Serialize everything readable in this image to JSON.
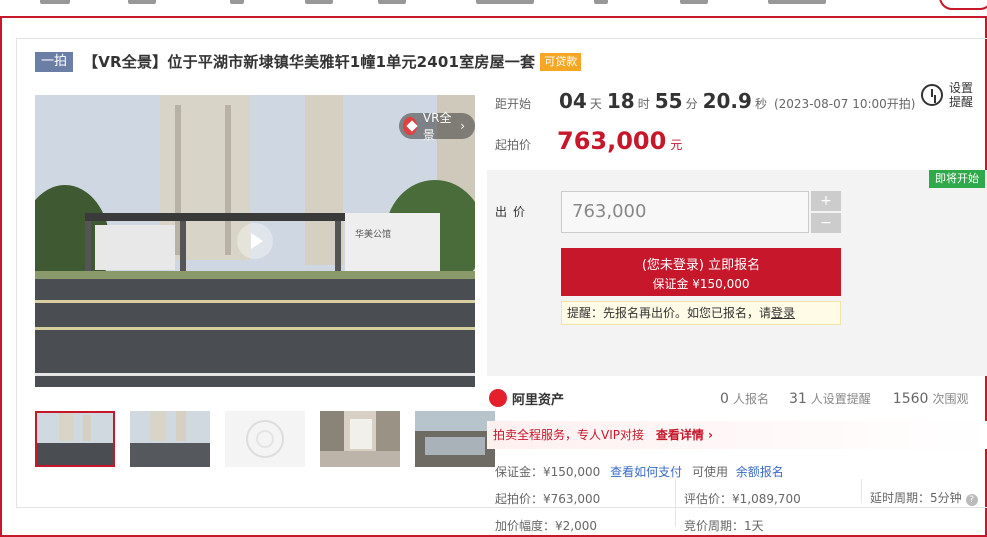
{
  "title": {
    "tag": "一拍",
    "text": "【VR全景】位于平湖市新埭镇华美雅轩1幢1单元2401室房屋一套",
    "loan_badge": "可贷款"
  },
  "media": {
    "vr_label": "VR全景",
    "gate_sign": "华美公馆",
    "thumbnail_count": 5
  },
  "countdown": {
    "label": "距开始",
    "days": "04",
    "days_unit": "天",
    "hours": "18",
    "hours_unit": "时",
    "minutes": "55",
    "minutes_unit": "分",
    "seconds": "20.9",
    "seconds_unit": "秒",
    "start_time": "(2023-08-07 10:00开拍)"
  },
  "remind": {
    "text": "设置提醒"
  },
  "start_price": {
    "label": "起拍价",
    "value": "763,000",
    "unit": "元"
  },
  "bid": {
    "status_tag": "即将开始",
    "label": "出价",
    "amount": "763,000",
    "plus": "+",
    "minus": "−",
    "signup_line1": "(您未登录) 立即报名",
    "signup_line2": "保证金 ¥150,000",
    "notice_text": "提醒：先报名再出价。如您已报名，请",
    "notice_link": "登录"
  },
  "stats": {
    "brand": "阿里资产",
    "signups": "0",
    "signups_unit": "人报名",
    "reminders": "31",
    "reminders_unit": "人设置提醒",
    "views": "1560",
    "views_unit": "次围观"
  },
  "vip": {
    "text": "拍卖全程服务，专人VIP对接",
    "link": "查看详情 ›"
  },
  "details": {
    "deposit": "保证金：¥150,000",
    "how_to_pay": "查看如何支付",
    "usable": "可使用",
    "yuebao": "余额报名",
    "start_price": "起拍价：¥763,000",
    "appraisal": "评估价：¥1,089,700",
    "delay": "延时周期：5分钟",
    "increment": "加价幅度：¥2,000",
    "cycle": "竞价周期：1天",
    "help": "?"
  }
}
